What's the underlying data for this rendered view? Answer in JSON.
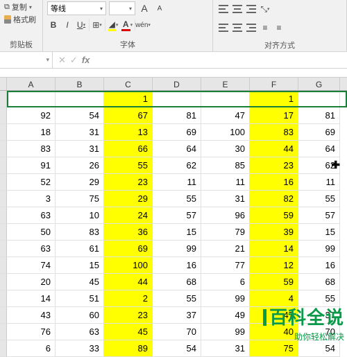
{
  "ribbon": {
    "clipboard": {
      "copy": "复制",
      "format_painter": "格式刷",
      "group": "剪贴板"
    },
    "font": {
      "name": "等线",
      "bold": "B",
      "italic": "I",
      "underline": "U",
      "wen": "wén",
      "group": "字体",
      "a_big": "A",
      "a_small": "A"
    },
    "align": {
      "group": "对齐方式"
    }
  },
  "formula_bar": {
    "cancel": "✕",
    "confirm": "✓",
    "fx": "fx",
    "value": ""
  },
  "columns": [
    "A",
    "B",
    "C",
    "D",
    "E",
    "F",
    "G"
  ],
  "header_row": [
    "",
    "",
    "1",
    "",
    "",
    "1",
    ""
  ],
  "data": [
    [
      92,
      54,
      67,
      81,
      47,
      17,
      81
    ],
    [
      18,
      31,
      13,
      69,
      100,
      83,
      69
    ],
    [
      83,
      31,
      66,
      64,
      30,
      44,
      64
    ],
    [
      91,
      26,
      55,
      62,
      85,
      23,
      62
    ],
    [
      52,
      29,
      23,
      11,
      11,
      16,
      11
    ],
    [
      3,
      75,
      29,
      55,
      31,
      82,
      55
    ],
    [
      63,
      10,
      24,
      57,
      96,
      59,
      57
    ],
    [
      50,
      83,
      36,
      15,
      79,
      39,
      15
    ],
    [
      63,
      61,
      69,
      99,
      21,
      14,
      99
    ],
    [
      74,
      15,
      100,
      16,
      77,
      12,
      16
    ],
    [
      20,
      45,
      44,
      68,
      6,
      59,
      68
    ],
    [
      14,
      51,
      2,
      55,
      99,
      4,
      55
    ],
    [
      43,
      60,
      23,
      37,
      49,
      47,
      37
    ],
    [
      76,
      63,
      45,
      70,
      99,
      40,
      70
    ],
    [
      6,
      33,
      89,
      54,
      31,
      75,
      54
    ]
  ],
  "watermark": {
    "title": "百科全说",
    "subtitle": "助你轻松解决"
  }
}
